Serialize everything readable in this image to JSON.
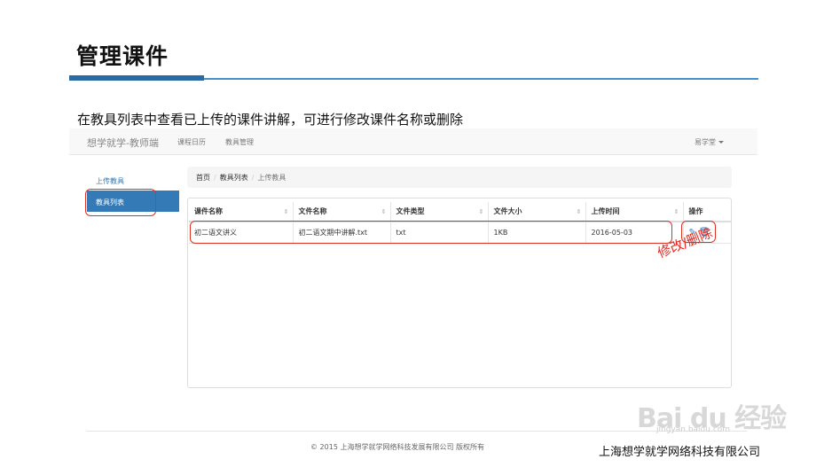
{
  "slide": {
    "title": "管理课件",
    "description": "在教具列表中查看已上传的课件讲解，可进行修改课件名称或删除",
    "annotation": "修改/删除",
    "company": "上海想学就学网络科技有限公司"
  },
  "app": {
    "brand": "想学就学-教师端",
    "nav": [
      "课程日历",
      "教具管理"
    ],
    "user": "易学堂"
  },
  "sidebar": {
    "items": [
      {
        "label": "上传教具"
      },
      {
        "label": "教具列表"
      }
    ]
  },
  "breadcrumb": [
    "首页",
    "教具列表",
    "上传教具"
  ],
  "table": {
    "headers": [
      "课件名称",
      "文件名称",
      "文件类型",
      "文件大小",
      "上传时间",
      "操作"
    ],
    "rows": [
      [
        "初二语文讲义",
        "初二语文期中讲解.txt",
        "txt",
        "1KB",
        "2016-05-03"
      ]
    ]
  },
  "footer": "© 2015 上海想学就学网络科技发展有限公司 版权所有",
  "watermark": {
    "text": "Bai du 经验",
    "sub": "jingyan.baidu.com"
  },
  "colors": {
    "accent": "#337ab7",
    "highlight": "#e03020",
    "title_bar": "#2a6aa5"
  }
}
